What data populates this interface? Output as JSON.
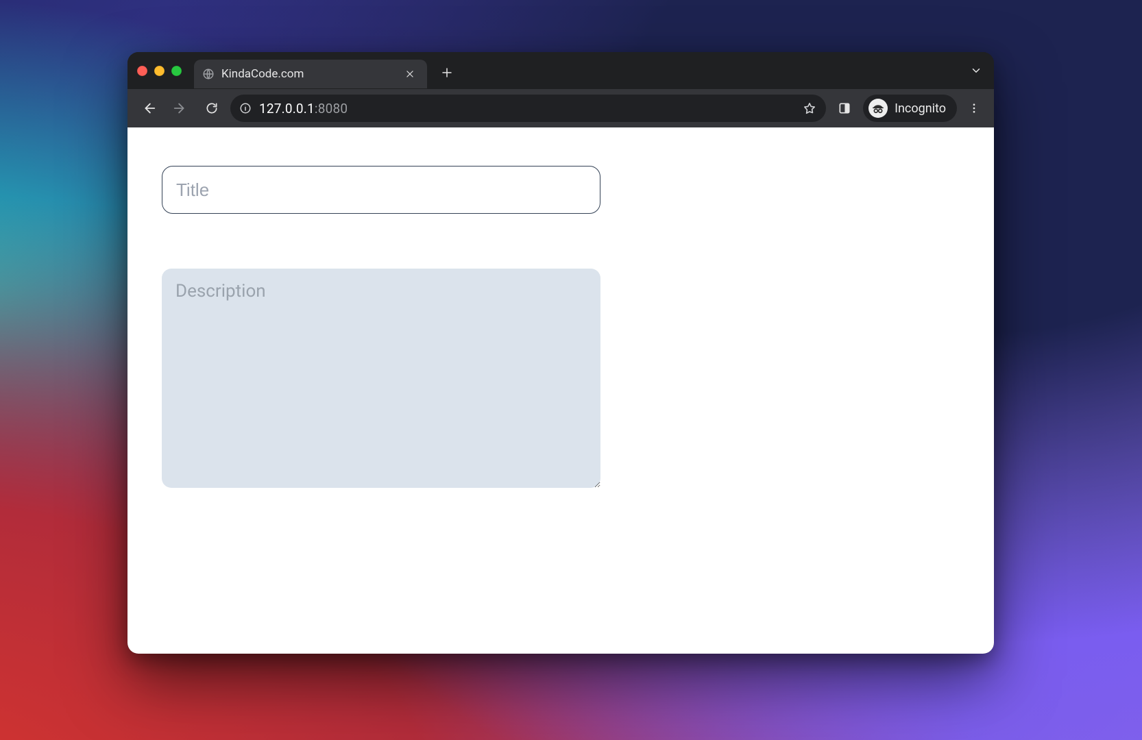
{
  "browser": {
    "tab": {
      "title": "KindaCode.com"
    },
    "address": {
      "host": "127.0.0.1",
      "port": ":8080"
    },
    "incognito_label": "Incognito"
  },
  "page": {
    "title_input": {
      "placeholder": "Title",
      "value": ""
    },
    "description_input": {
      "placeholder": "Description",
      "value": ""
    }
  }
}
